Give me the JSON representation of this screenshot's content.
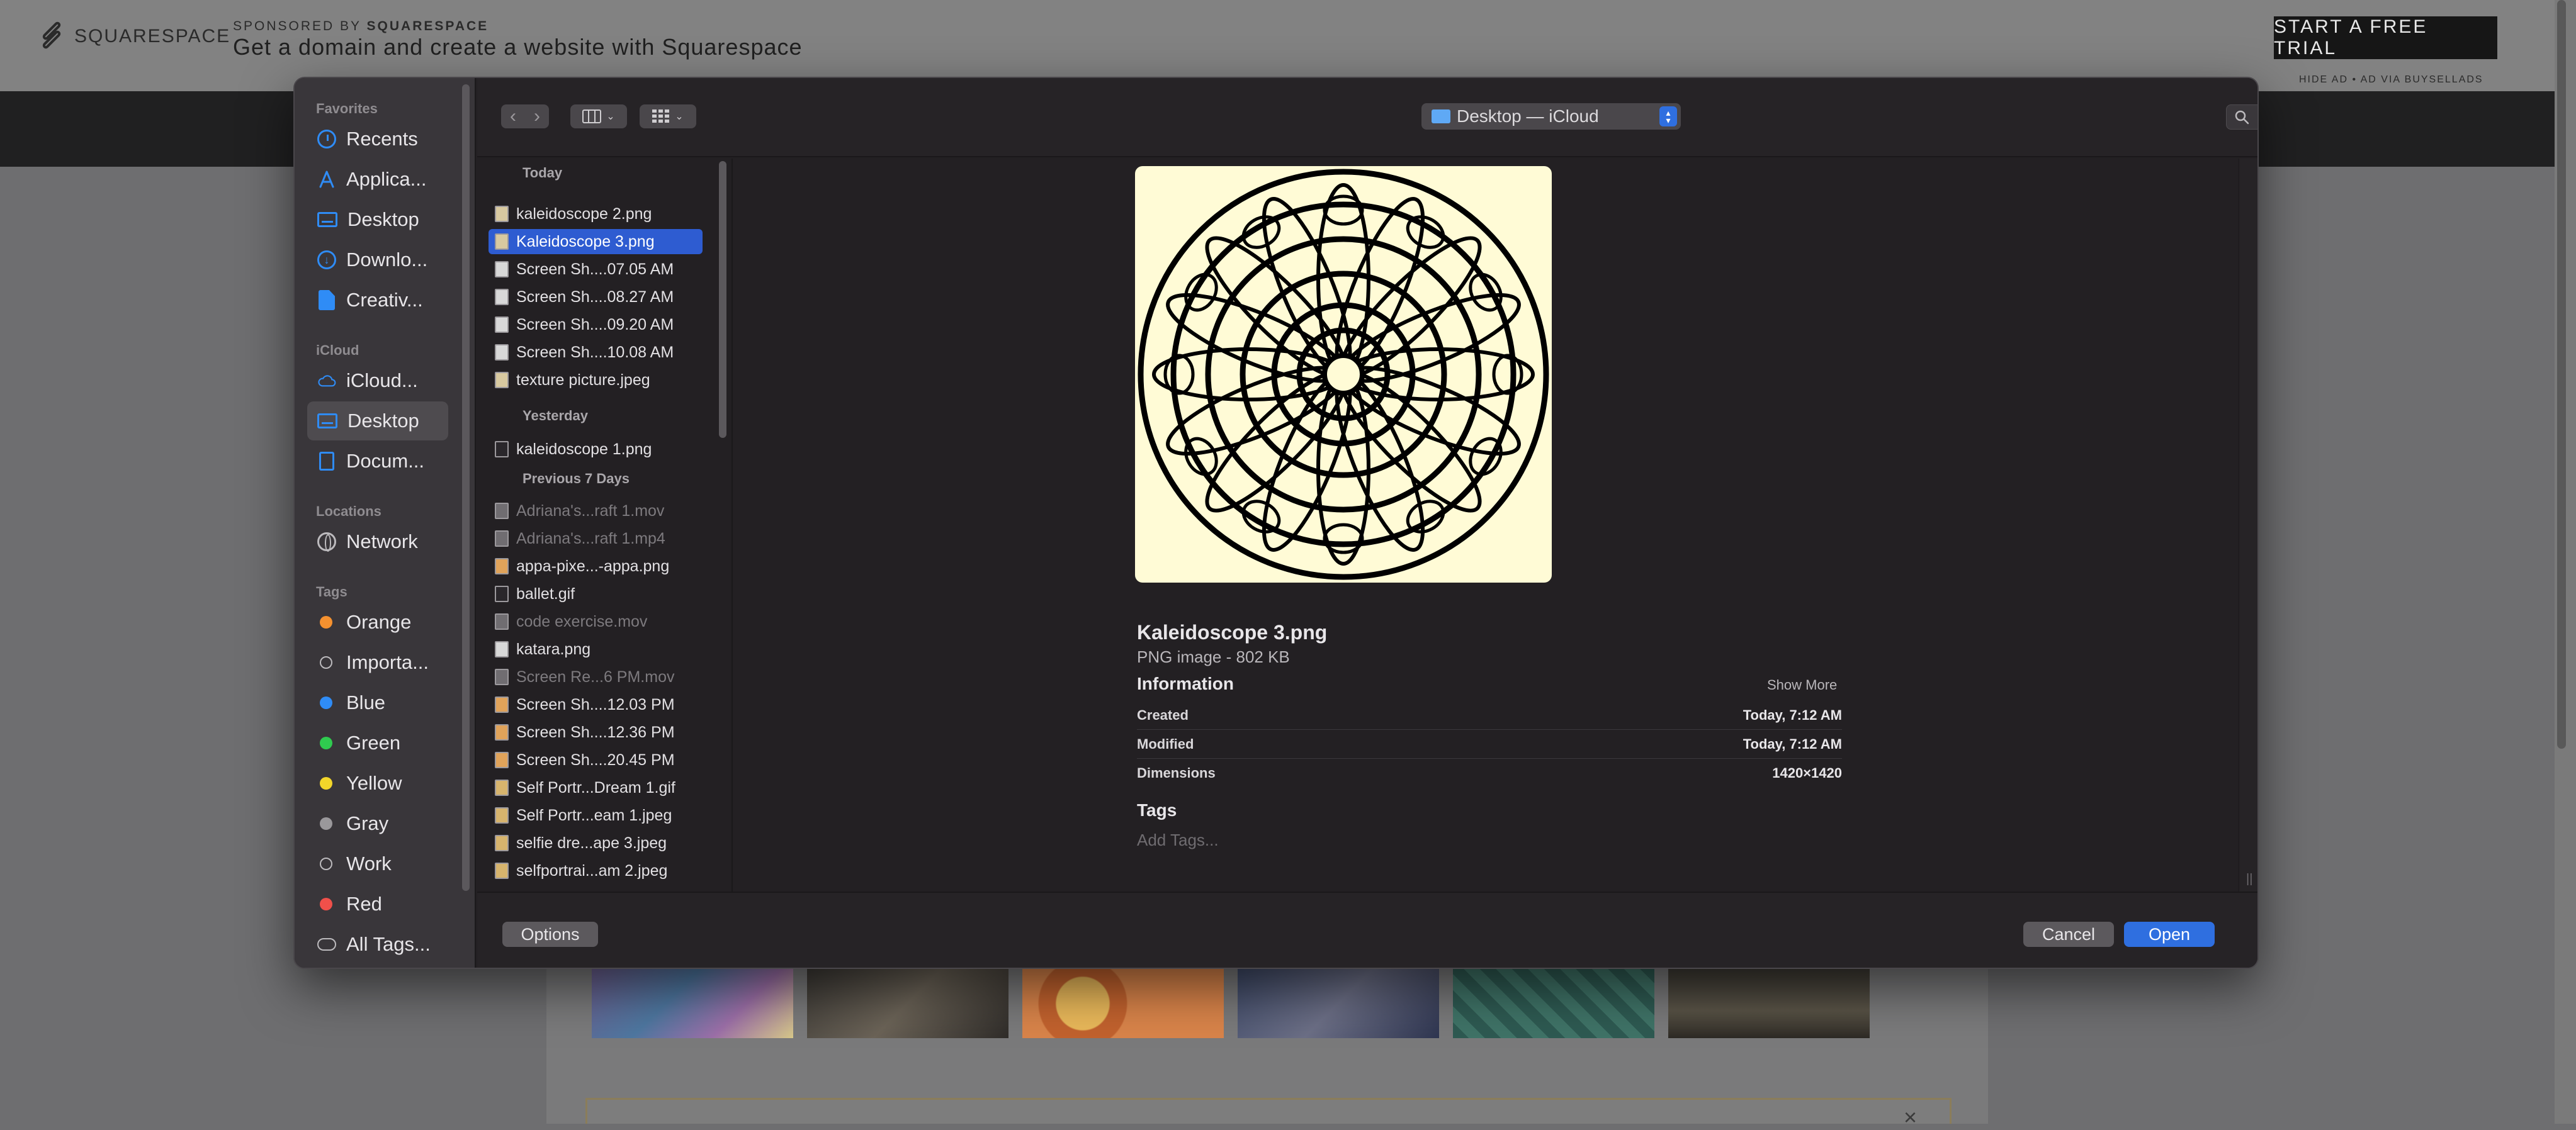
{
  "background": {
    "brand": "SQUARESPACE",
    "sponsor_prefix": "SPONSORED BY",
    "sponsor_brand": "SQUARESPACE",
    "ad_text": "Get a domain and create a website with Squarespace",
    "cta": "START A FREE TRIAL",
    "hide_ad": "HIDE AD • AD VIA BUYSELLADS"
  },
  "sidebar": {
    "favorites_label": "Favorites",
    "favorites": [
      "Recents",
      "Applica...",
      "Desktop",
      "Downlo...",
      "Creativ..."
    ],
    "icloud_label": "iCloud",
    "icloud": [
      "iCloud...",
      "Desktop",
      "Docum..."
    ],
    "locations_label": "Locations",
    "locations": [
      "Network"
    ],
    "tags_label": "Tags",
    "tags": [
      {
        "name": "Orange",
        "color": "#f5912f"
      },
      {
        "name": "Importa...",
        "color": ""
      },
      {
        "name": "Blue",
        "color": "#2f8cf6"
      },
      {
        "name": "Green",
        "color": "#2fcb4f"
      },
      {
        "name": "Yellow",
        "color": "#f2d62a"
      },
      {
        "name": "Gray",
        "color": "#9a989b"
      },
      {
        "name": "Work",
        "color": ""
      },
      {
        "name": "Red",
        "color": "#f0504a"
      },
      {
        "name": "All Tags...",
        "color": ""
      }
    ]
  },
  "toolbar": {
    "path_label": "Desktop — iCloud",
    "search_placeholder": "Search"
  },
  "filelist": {
    "groups": [
      "Today",
      "Yesterday",
      "Previous 7 Days"
    ],
    "today": [
      "kaleidoscope 2.png",
      "Kaleidoscope 3.png",
      "Screen Sh....07.05 AM",
      "Screen Sh....08.27 AM",
      "Screen Sh....09.20 AM",
      "Screen Sh....10.08 AM",
      "texture picture.jpeg"
    ],
    "yesterday": [
      "kaleidoscope 1.png"
    ],
    "previous": [
      "Adriana's...raft 1.mov",
      "Adriana's...raft 1.mp4",
      "appa-pixe...-appa.png",
      "ballet.gif",
      "code exercise.mov",
      "katara.png",
      "Screen Re...6 PM.mov",
      "Screen Sh....12.03 PM",
      "Screen Sh....12.36 PM",
      "Screen Sh....20.45 PM",
      "Self Portr...Dream 1.gif",
      "Self Portr...eam 1.jpeg",
      "selfie dre...ape 3.jpeg",
      "selfportrai...am 2.jpeg"
    ]
  },
  "preview": {
    "name": "Kaleidoscope 3.png",
    "kind": "PNG image - 802 KB",
    "info_heading": "Information",
    "show_more": "Show More",
    "rows": [
      {
        "label": "Created",
        "value": "Today, 7:12 AM"
      },
      {
        "label": "Modified",
        "value": "Today, 7:12 AM"
      },
      {
        "label": "Dimensions",
        "value": "1420×1420"
      }
    ],
    "tags_heading": "Tags",
    "tags_placeholder": "Add Tags..."
  },
  "footer": {
    "options": "Options",
    "cancel": "Cancel",
    "open": "Open"
  },
  "colors": {
    "accent": "#2f6fe0",
    "selection": "#2e5cd1",
    "image_background": "#fffbd6"
  }
}
